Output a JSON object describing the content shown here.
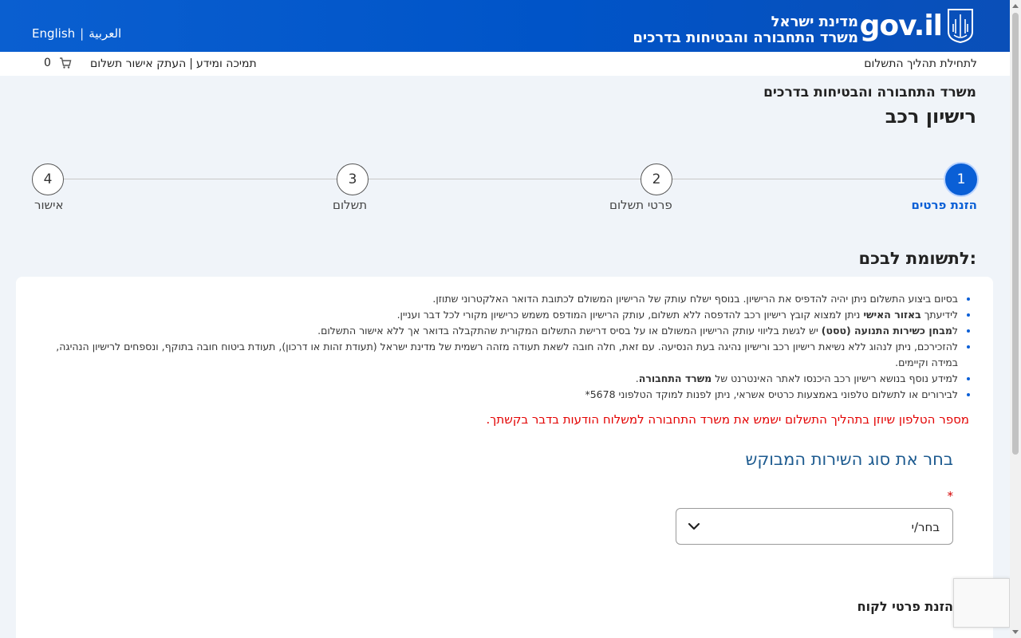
{
  "header": {
    "lang_arabic": "العربية",
    "lang_separator": "|",
    "lang_english": "English",
    "brand_line1": "מדינת ישראל",
    "brand_line2": "משרד התחבורה והבטיחות בדרכים",
    "logo_text": "gov.il"
  },
  "subbar": {
    "start_process": "לתחילת תהליך התשלום",
    "support": "תמיכה ומידע",
    "separator": "|",
    "copy_receipt": "העתק אישור תשלום",
    "cart_count": "0"
  },
  "page": {
    "ministry": "משרד התחבורה והבטיחות בדרכים",
    "title": "רישיון רכב"
  },
  "stepper": {
    "steps": [
      {
        "number": "1",
        "label": "הזנת פרטים",
        "active": true
      },
      {
        "number": "2",
        "label": "פרטי תשלום",
        "active": false
      },
      {
        "number": "3",
        "label": "תשלום",
        "active": false
      },
      {
        "number": "4",
        "label": "אישור",
        "active": false
      }
    ]
  },
  "notice": {
    "title": "לתשומת לבכם:",
    "items": [
      {
        "pre": "",
        "bold": "",
        "post": "בסיום ביצוע התשלום ניתן יהיה להדפיס את הרישיון. בנוסף ישלח עותק של הרישיון המשולם לכתובת הדואר האלקטרוני שתוזן."
      },
      {
        "pre": "לידיעתך ",
        "bold": "באזור האישי",
        "post": " ניתן למצוא קובץ רישיון רכב להדפסה ללא תשלום, עותק הרישיון המודפס משמש כרישיון מקורי לכל דבר ועניין."
      },
      {
        "pre": "ל",
        "bold": "מבחן כשירות התנועה (טסט)",
        "post": " יש לגשת בליווי עותק הרישיון המשולם או על בסיס דרישת התשלום המקורית שהתקבלה בדואר אך ללא אישור התשלום."
      },
      {
        "pre": "",
        "bold": "",
        "post": "להזכירכם, ניתן לנהוג ללא נשיאת רישיון רכב ורישיון נהיגה בעת הנסיעה. עם זאת, חלה חובה לשאת תעודה מזהה רשמית של מדינת ישראל (תעודת זהות או דרכון), תעודת ביטוח חובה בתוקף, ונספחים לרישיון הנהיגה, במידה וקיימים."
      },
      {
        "pre": "למידע נוסף בנושא רישיון רכב היכנסו לאתר האינטרנט של ",
        "bold": "משרד התחבורה",
        "post": "."
      },
      {
        "pre": "",
        "bold": "",
        "post": "לבירורים או לתשלום טלפוני באמצעות כרטיס אשראי, ניתן לפנות למוקד הטלפוני 5678*"
      }
    ],
    "alert": "מספר הטלפון שיוזן בתהליך התשלום ישמש את משרד התחבורה למשלוח הודעות בדבר בקשתך."
  },
  "service": {
    "title": "בחר את סוג השירות המבוקש",
    "required_mark": "*",
    "select_value": "בחר/י"
  },
  "customer": {
    "title": "הזנת פרטי לקוח"
  },
  "colors": {
    "header_blue": "#0a5fd0",
    "active_step": "#0a5fd6",
    "alert_red": "#e30000"
  }
}
